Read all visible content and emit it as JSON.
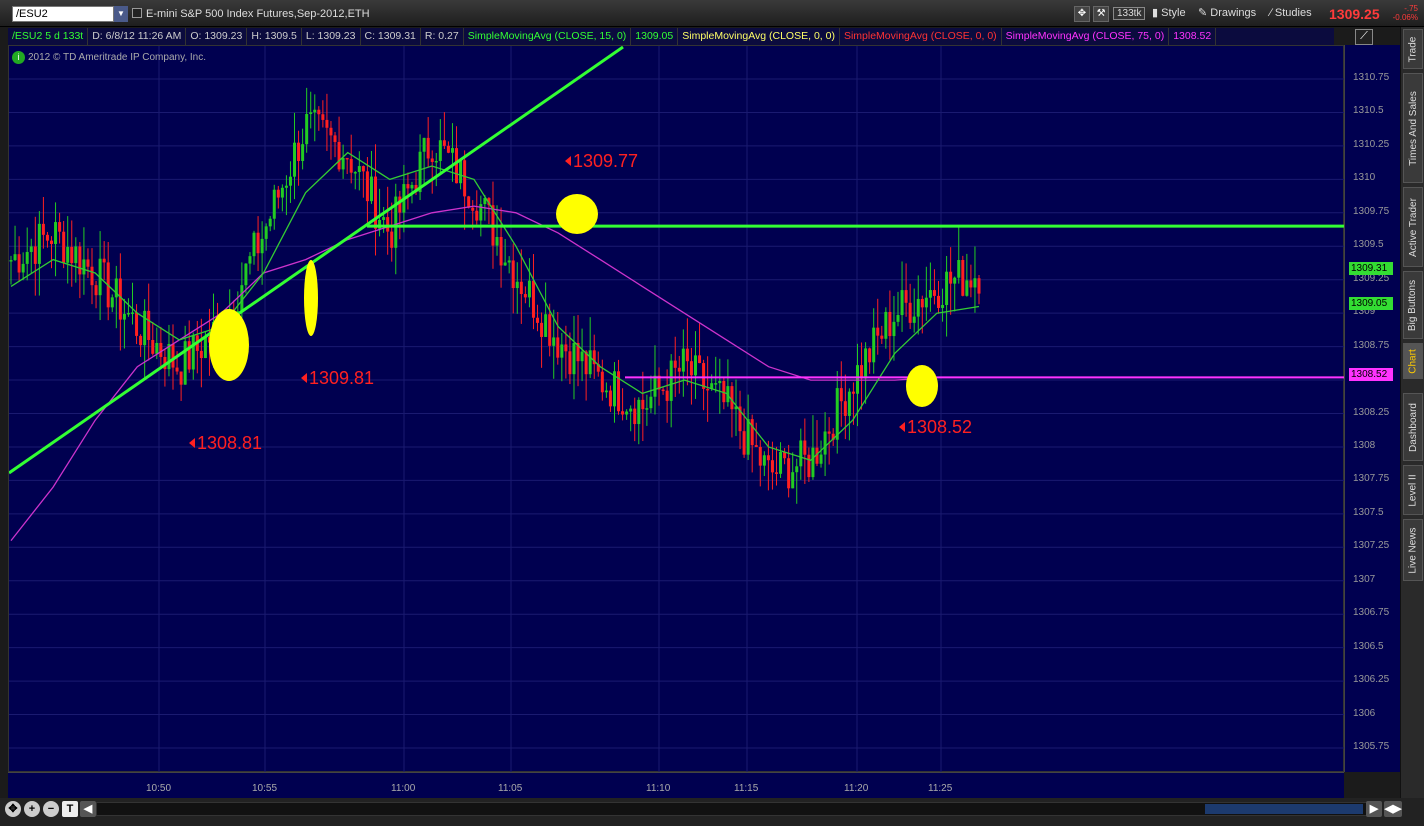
{
  "toolbar": {
    "symbol": "/ESU2",
    "description": "E-mini S&P 500 Index Futures,Sep-2012,ETH",
    "tick_badge": "133tk",
    "style": "Style",
    "drawings": "Drawings",
    "studies": "Studies",
    "last_price": "1309.25",
    "change": "-.75",
    "change_pct": "-0.06%"
  },
  "status_bar": {
    "symbol_period": "/ESU2 5 d 133t",
    "date": "D: 6/8/12 11:26 AM",
    "open": "O: 1309.23",
    "high": "H: 1309.5",
    "low": "L: 1309.23",
    "close": "C: 1309.31",
    "range": "R: 0.27",
    "studies": [
      {
        "label": "SimpleMovingAvg (CLOSE, 15, 0)",
        "value": "1309.05",
        "color": "#33ff33"
      },
      {
        "label": "SimpleMovingAvg (CLOSE, 0, 0)",
        "value": "",
        "color": "#ffff66"
      },
      {
        "label": "SimpleMovingAvg (CLOSE, 0, 0)",
        "value": "",
        "color": "#ff3333"
      },
      {
        "label": "SimpleMovingAvg (CLOSE, 75, 0)",
        "value": "1308.52",
        "color": "#ff33ff"
      }
    ]
  },
  "copyright": "2012 © TD Ameritrade IP Company, Inc.",
  "price_axis": {
    "labels": [
      "1310.75",
      "1310.5",
      "1310.25",
      "1310",
      "1309.75",
      "1309.5",
      "1309.25",
      "1309",
      "1308.75",
      "1308.5",
      "1308.25",
      "1308",
      "1307.75",
      "1307.5",
      "1307.25",
      "1307",
      "1306.75",
      "1306.5",
      "1306.25",
      "1306",
      "1305.75"
    ],
    "badge_last": "1309.31",
    "badge_sma15": "1309.05",
    "badge_sma75": "1308.52"
  },
  "time_axis": [
    "10:50",
    "10:55",
    "11:00",
    "11:05",
    "11:10",
    "11:15",
    "11:20",
    "11:25"
  ],
  "annotations": [
    {
      "text": "1309.77"
    },
    {
      "text": "1309.81"
    },
    {
      "text": "1308.81"
    },
    {
      "text": "1308.52"
    }
  ],
  "side_tabs": [
    "Trade",
    "Times And Sales",
    "Active Trader",
    "Big Buttons",
    "Chart",
    "Dashboard",
    "Level II",
    "Live News"
  ],
  "colors": {
    "chart_bg": "#000050",
    "up_bar": "#22cc22",
    "down_bar": "#ff2020",
    "trendline": "#33ff33",
    "sma15": "#33cc33",
    "sma75": "#cc33cc",
    "magenta_line": "#ff33ff",
    "highlight": "#ffff00"
  },
  "chart_data": {
    "type": "candlestick",
    "title": "E-mini S&P 500 Index Futures,Sep-2012,ETH",
    "ylim": [
      1305.5,
      1311
    ],
    "x": [
      "10:48",
      "10:50",
      "10:52",
      "10:54",
      "10:55",
      "10:57",
      "10:59",
      "11:00",
      "11:02",
      "11:04",
      "11:05",
      "11:07",
      "11:09",
      "11:10",
      "11:12",
      "11:14",
      "11:15",
      "11:17",
      "11:19",
      "11:20",
      "11:22",
      "11:24",
      "11:25",
      "11:26"
    ],
    "close": [
      1309.4,
      1309.6,
      1309.3,
      1308.9,
      1308.6,
      1308.9,
      1309.6,
      1310.4,
      1310.2,
      1309.6,
      1310.3,
      1309.9,
      1309.3,
      1308.8,
      1308.5,
      1308.3,
      1308.6,
      1308.3,
      1307.8,
      1307.9,
      1308.5,
      1309.0,
      1309.2,
      1309.31
    ],
    "sma15": [
      1309.2,
      1309.4,
      1309.3,
      1309.0,
      1308.8,
      1308.9,
      1309.3,
      1309.9,
      1310.2,
      1310.0,
      1310.1,
      1310.0,
      1309.5,
      1308.9,
      1308.6,
      1308.4,
      1308.5,
      1308.4,
      1308.0,
      1307.9,
      1308.2,
      1308.7,
      1309.0,
      1309.05
    ],
    "sma75": [
      1307.3,
      1307.7,
      1308.2,
      1308.6,
      1308.8,
      1309.0,
      1309.3,
      1309.4,
      1309.55,
      1309.65,
      1309.75,
      1309.8,
      1309.75,
      1309.6,
      1309.4,
      1309.2,
      1309.0,
      1308.8,
      1308.6,
      1308.5,
      1308.5,
      1308.5,
      1308.52,
      1308.52
    ],
    "horizontal_lines": [
      {
        "price": 1309.65,
        "color": "#33ff33"
      },
      {
        "price": 1308.52,
        "color": "#ff33ff"
      }
    ]
  }
}
